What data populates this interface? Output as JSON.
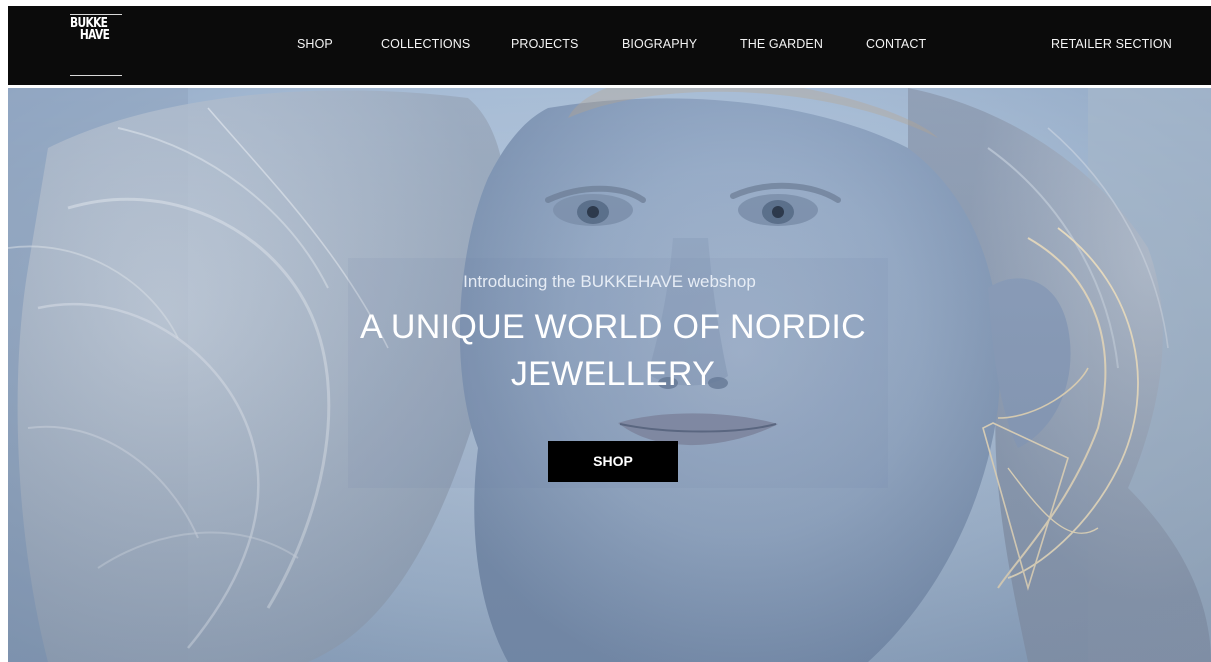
{
  "brand": {
    "logo_line1": "BUKKE",
    "logo_line2": "HAVE"
  },
  "nav": {
    "items": [
      "SHOP",
      "COLLECTIONS",
      "PROJECTS",
      "BIOGRAPHY",
      "THE GARDEN",
      "CONTACT"
    ],
    "retailer": "RETAILER SECTION"
  },
  "hero": {
    "intro": "Introducing the BUKKEHAVE webshop",
    "headline": "A UNIQUE WORLD OF NORDIC JEWELLERY",
    "cta": "SHOP",
    "image": "portrait-with-wire-earring"
  },
  "colors": {
    "header_bg": "#0b0b0b",
    "nav_text": "#f4f4f4",
    "button_bg": "#000000",
    "button_text": "#ffffff",
    "hero_tint": "#9fb3cb"
  }
}
